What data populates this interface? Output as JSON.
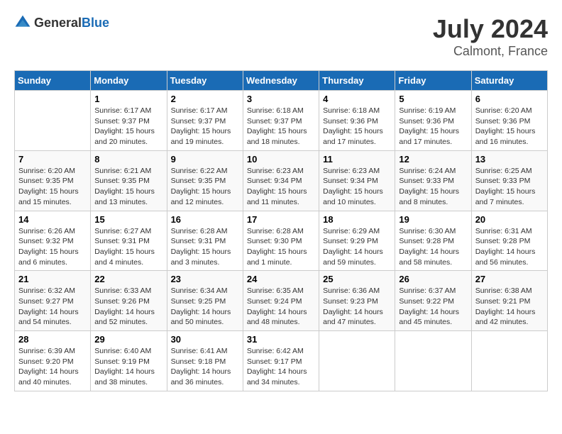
{
  "header": {
    "logo_general": "General",
    "logo_blue": "Blue",
    "month_year": "July 2024",
    "location": "Calmont, France"
  },
  "weekdays": [
    "Sunday",
    "Monday",
    "Tuesday",
    "Wednesday",
    "Thursday",
    "Friday",
    "Saturday"
  ],
  "weeks": [
    [
      {
        "day": "",
        "info": ""
      },
      {
        "day": "1",
        "info": "Sunrise: 6:17 AM\nSunset: 9:37 PM\nDaylight: 15 hours\nand 20 minutes."
      },
      {
        "day": "2",
        "info": "Sunrise: 6:17 AM\nSunset: 9:37 PM\nDaylight: 15 hours\nand 19 minutes."
      },
      {
        "day": "3",
        "info": "Sunrise: 6:18 AM\nSunset: 9:37 PM\nDaylight: 15 hours\nand 18 minutes."
      },
      {
        "day": "4",
        "info": "Sunrise: 6:18 AM\nSunset: 9:36 PM\nDaylight: 15 hours\nand 17 minutes."
      },
      {
        "day": "5",
        "info": "Sunrise: 6:19 AM\nSunset: 9:36 PM\nDaylight: 15 hours\nand 17 minutes."
      },
      {
        "day": "6",
        "info": "Sunrise: 6:20 AM\nSunset: 9:36 PM\nDaylight: 15 hours\nand 16 minutes."
      }
    ],
    [
      {
        "day": "7",
        "info": "Sunrise: 6:20 AM\nSunset: 9:35 PM\nDaylight: 15 hours\nand 15 minutes."
      },
      {
        "day": "8",
        "info": "Sunrise: 6:21 AM\nSunset: 9:35 PM\nDaylight: 15 hours\nand 13 minutes."
      },
      {
        "day": "9",
        "info": "Sunrise: 6:22 AM\nSunset: 9:35 PM\nDaylight: 15 hours\nand 12 minutes."
      },
      {
        "day": "10",
        "info": "Sunrise: 6:23 AM\nSunset: 9:34 PM\nDaylight: 15 hours\nand 11 minutes."
      },
      {
        "day": "11",
        "info": "Sunrise: 6:23 AM\nSunset: 9:34 PM\nDaylight: 15 hours\nand 10 minutes."
      },
      {
        "day": "12",
        "info": "Sunrise: 6:24 AM\nSunset: 9:33 PM\nDaylight: 15 hours\nand 8 minutes."
      },
      {
        "day": "13",
        "info": "Sunrise: 6:25 AM\nSunset: 9:33 PM\nDaylight: 15 hours\nand 7 minutes."
      }
    ],
    [
      {
        "day": "14",
        "info": "Sunrise: 6:26 AM\nSunset: 9:32 PM\nDaylight: 15 hours\nand 6 minutes."
      },
      {
        "day": "15",
        "info": "Sunrise: 6:27 AM\nSunset: 9:31 PM\nDaylight: 15 hours\nand 4 minutes."
      },
      {
        "day": "16",
        "info": "Sunrise: 6:28 AM\nSunset: 9:31 PM\nDaylight: 15 hours\nand 3 minutes."
      },
      {
        "day": "17",
        "info": "Sunrise: 6:28 AM\nSunset: 9:30 PM\nDaylight: 15 hours\nand 1 minute."
      },
      {
        "day": "18",
        "info": "Sunrise: 6:29 AM\nSunset: 9:29 PM\nDaylight: 14 hours\nand 59 minutes."
      },
      {
        "day": "19",
        "info": "Sunrise: 6:30 AM\nSunset: 9:28 PM\nDaylight: 14 hours\nand 58 minutes."
      },
      {
        "day": "20",
        "info": "Sunrise: 6:31 AM\nSunset: 9:28 PM\nDaylight: 14 hours\nand 56 minutes."
      }
    ],
    [
      {
        "day": "21",
        "info": "Sunrise: 6:32 AM\nSunset: 9:27 PM\nDaylight: 14 hours\nand 54 minutes."
      },
      {
        "day": "22",
        "info": "Sunrise: 6:33 AM\nSunset: 9:26 PM\nDaylight: 14 hours\nand 52 minutes."
      },
      {
        "day": "23",
        "info": "Sunrise: 6:34 AM\nSunset: 9:25 PM\nDaylight: 14 hours\nand 50 minutes."
      },
      {
        "day": "24",
        "info": "Sunrise: 6:35 AM\nSunset: 9:24 PM\nDaylight: 14 hours\nand 48 minutes."
      },
      {
        "day": "25",
        "info": "Sunrise: 6:36 AM\nSunset: 9:23 PM\nDaylight: 14 hours\nand 47 minutes."
      },
      {
        "day": "26",
        "info": "Sunrise: 6:37 AM\nSunset: 9:22 PM\nDaylight: 14 hours\nand 45 minutes."
      },
      {
        "day": "27",
        "info": "Sunrise: 6:38 AM\nSunset: 9:21 PM\nDaylight: 14 hours\nand 42 minutes."
      }
    ],
    [
      {
        "day": "28",
        "info": "Sunrise: 6:39 AM\nSunset: 9:20 PM\nDaylight: 14 hours\nand 40 minutes."
      },
      {
        "day": "29",
        "info": "Sunrise: 6:40 AM\nSunset: 9:19 PM\nDaylight: 14 hours\nand 38 minutes."
      },
      {
        "day": "30",
        "info": "Sunrise: 6:41 AM\nSunset: 9:18 PM\nDaylight: 14 hours\nand 36 minutes."
      },
      {
        "day": "31",
        "info": "Sunrise: 6:42 AM\nSunset: 9:17 PM\nDaylight: 14 hours\nand 34 minutes."
      },
      {
        "day": "",
        "info": ""
      },
      {
        "day": "",
        "info": ""
      },
      {
        "day": "",
        "info": ""
      }
    ]
  ]
}
